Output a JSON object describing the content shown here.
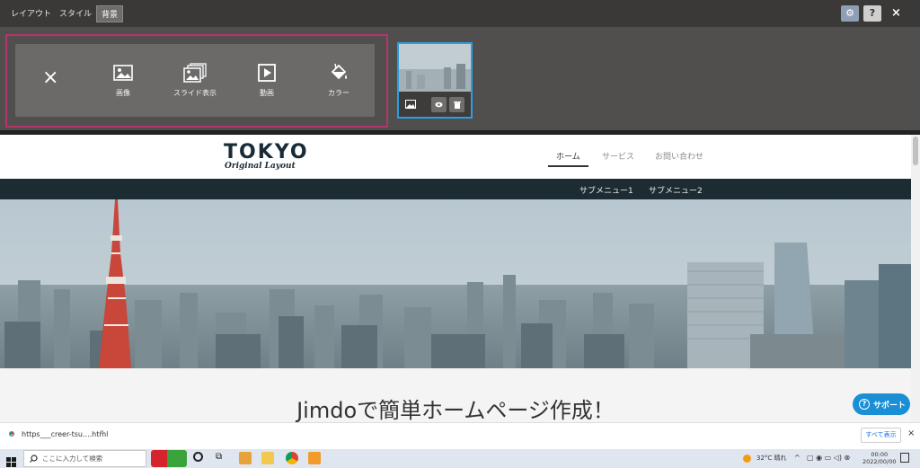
{
  "editor": {
    "tabs": [
      "レイアウト",
      "スタイル",
      "背景"
    ],
    "active_tab": "背景",
    "gear_label": "⚙",
    "help_label": "?",
    "close_label": "×"
  },
  "background_panel": {
    "close_label": "×",
    "tools": [
      {
        "label": "画像",
        "icon": "image-icon"
      },
      {
        "label": "スライド表示",
        "icon": "slideshow-icon"
      },
      {
        "label": "動画",
        "icon": "video-icon"
      },
      {
        "label": "カラー",
        "icon": "paint-bucket-icon"
      }
    ],
    "thumbnail_actions": [
      "image-icon",
      "eye-icon",
      "trash-icon"
    ],
    "accent_color": "#2d9ee0",
    "highlight_color": "#b5356a"
  },
  "site": {
    "logo_main": "TOKYO",
    "logo_sub": "Original Layout",
    "nav": [
      "ホーム",
      "サービス",
      "お問い合わせ"
    ],
    "active_nav": "ホーム",
    "subnav": [
      "サブメニュー1",
      "サブメニュー2"
    ],
    "headline": "Jimdoで簡単ホームページ作成！",
    "support_label": "サポート",
    "support_icon": "?"
  },
  "download_bar": {
    "file": "https___creer-tsu....html",
    "show_all": "すべて表示",
    "close_label": "×"
  },
  "taskbar": {
    "search_placeholder": "ここに入力して検索",
    "weather": "32°C 晴れ",
    "time": "00:00",
    "date": "2022/00/00"
  }
}
